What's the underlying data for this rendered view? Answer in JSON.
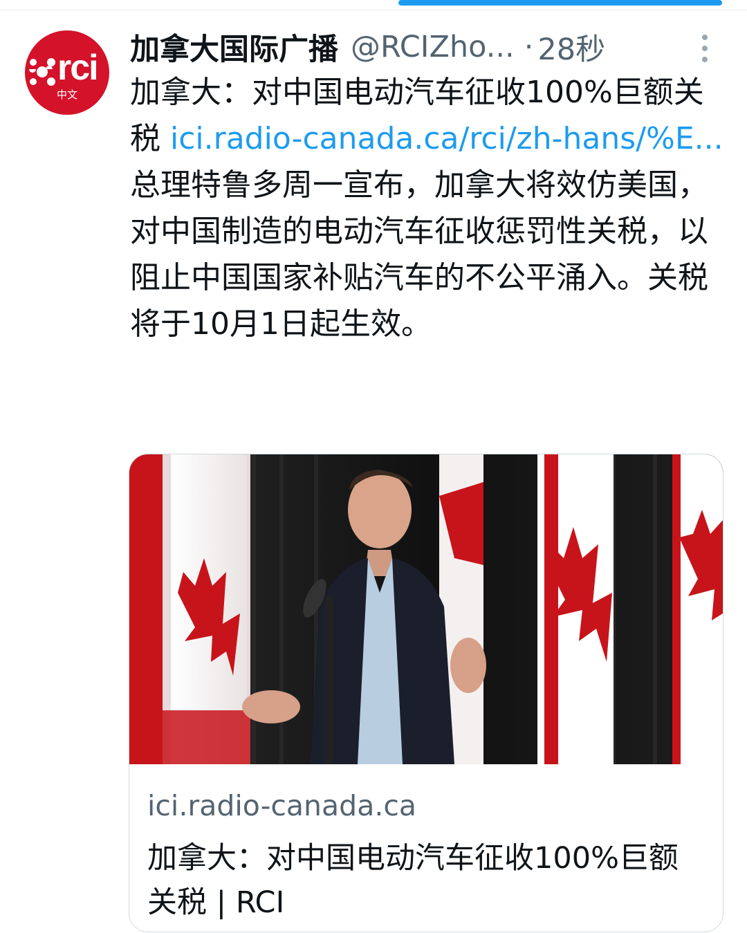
{
  "author": {
    "name": "加拿大国际广播",
    "handle": "@RCIZho...",
    "separator": "·",
    "time": "28秒",
    "avatar_logo": "rci",
    "avatar_sub": "中文"
  },
  "tweet": {
    "headline": "加拿大：对中国电动汽车征收100%巨额关税",
    "link_text": "ici.radio-canada.ca/rci/zh-hans/%E...",
    "body": "总理特鲁多周一宣布，加拿大将效仿美国，对中国制造的电动汽车征收惩罚性关税，以阻止中国国家补贴汽车的不公平涌入。关税将于10月1日起生效。"
  },
  "card": {
    "domain": "ici.radio-canada.ca",
    "title": "加拿大：对中国电动汽车征收100%巨额关税 | RCI"
  },
  "colors": {
    "link": "#1d9bf0",
    "brand_red": "#d4122a",
    "text_secondary": "#536471",
    "border": "#cfd9de"
  },
  "icons": {
    "more": "more-vertical-icon"
  }
}
